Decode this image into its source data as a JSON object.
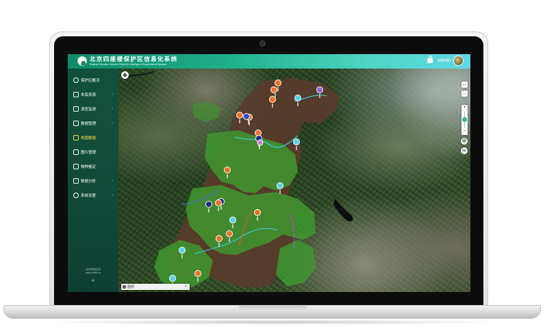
{
  "app": {
    "title": "北京四座楼保护区信息化系统",
    "subtitle": "Beijing Sizuolou Nature Reserve Intelligent Supervision System"
  },
  "user": {
    "name": "admin"
  },
  "sidebar": {
    "items": [
      {
        "label": "保护区概况",
        "icon": "info-icon",
        "has_chevron": false,
        "active": false
      },
      {
        "label": "本底资源",
        "icon": "folder-icon",
        "has_chevron": true,
        "active": false
      },
      {
        "label": "调查监测",
        "icon": "monitor-icon",
        "has_chevron": true,
        "active": false
      },
      {
        "label": "数据管理",
        "icon": "database-icon",
        "has_chevron": true,
        "active": false
      },
      {
        "label": "地图数据",
        "icon": "map-icon",
        "has_chevron": false,
        "active": true
      },
      {
        "label": "图片管理",
        "icon": "image-icon",
        "has_chevron": false,
        "active": false
      },
      {
        "label": "物种鉴定",
        "icon": "species-icon",
        "has_chevron": false,
        "active": false
      },
      {
        "label": "数据分析",
        "icon": "analysis-icon",
        "has_chevron": true,
        "active": false
      },
      {
        "label": "系统设置",
        "icon": "gear-icon",
        "has_chevron": true,
        "active": false
      }
    ],
    "footer_line1": "北京网园生态",
    "footer_line2": "www.zhibit.cn",
    "collapse_glyph": "«"
  },
  "map": {
    "controls": {
      "scale": "1:1",
      "fullscreen_glyph": "⛶",
      "zoom_in": "+",
      "zoom_out": "−",
      "locate_glyph": "◎",
      "mode": "2D"
    },
    "legend": {
      "label": "图例",
      "chevron": "▾"
    },
    "colors": {
      "reserve_fill": "#3f9a2f",
      "reserve_core": "#5a3a2a",
      "trail": "#36c6d8",
      "pin_orange": "#e8742a",
      "pin_cyan": "#5ad0e6",
      "pin_navy": "#1e2a8a",
      "pin_purple": "#8a66d6"
    }
  }
}
